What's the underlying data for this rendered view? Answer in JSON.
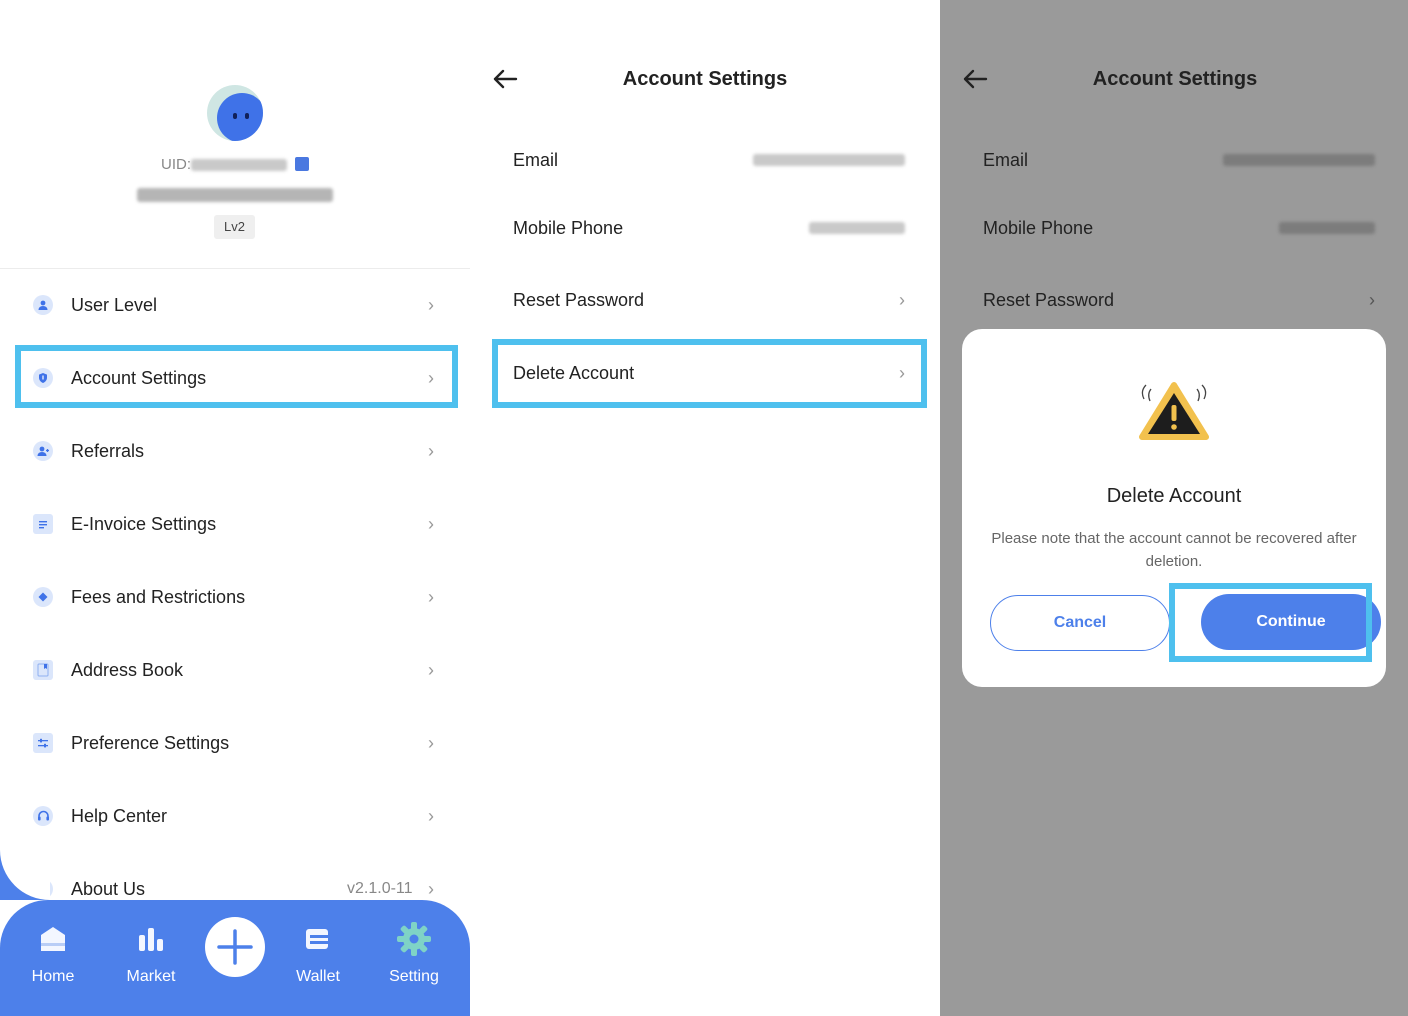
{
  "colors": {
    "accent": "#4d80ea",
    "highlight": "#4ec0ee",
    "overlay": "#9a9a9a"
  },
  "profile": {
    "uid_label": "UID:",
    "level": "Lv2"
  },
  "menu": [
    {
      "label": "User Level",
      "icon": "user-icon"
    },
    {
      "label": "Account Settings",
      "icon": "shield-icon"
    },
    {
      "label": "Referrals",
      "icon": "add-user-icon"
    },
    {
      "label": "E-Invoice Settings",
      "icon": "invoice-icon"
    },
    {
      "label": "Fees and Restrictions",
      "icon": "diamond-icon"
    },
    {
      "label": "Address Book",
      "icon": "book-icon"
    },
    {
      "label": "Preference Settings",
      "icon": "sliders-icon"
    },
    {
      "label": "Help Center",
      "icon": "headset-icon"
    },
    {
      "label": "About Us",
      "icon": "info-icon",
      "version": "v2.1.0-11"
    }
  ],
  "bottom_nav": {
    "home": "Home",
    "market": "Market",
    "wallet": "Wallet",
    "setting": "Setting"
  },
  "account_settings": {
    "title": "Account Settings",
    "rows": {
      "email": "Email",
      "mobile": "Mobile Phone",
      "reset": "Reset Password",
      "delete": "Delete Account"
    }
  },
  "modal": {
    "title": "Delete Account",
    "body": "Please note that the account cannot be recovered after deletion.",
    "cancel": "Cancel",
    "continue": "Continue"
  }
}
